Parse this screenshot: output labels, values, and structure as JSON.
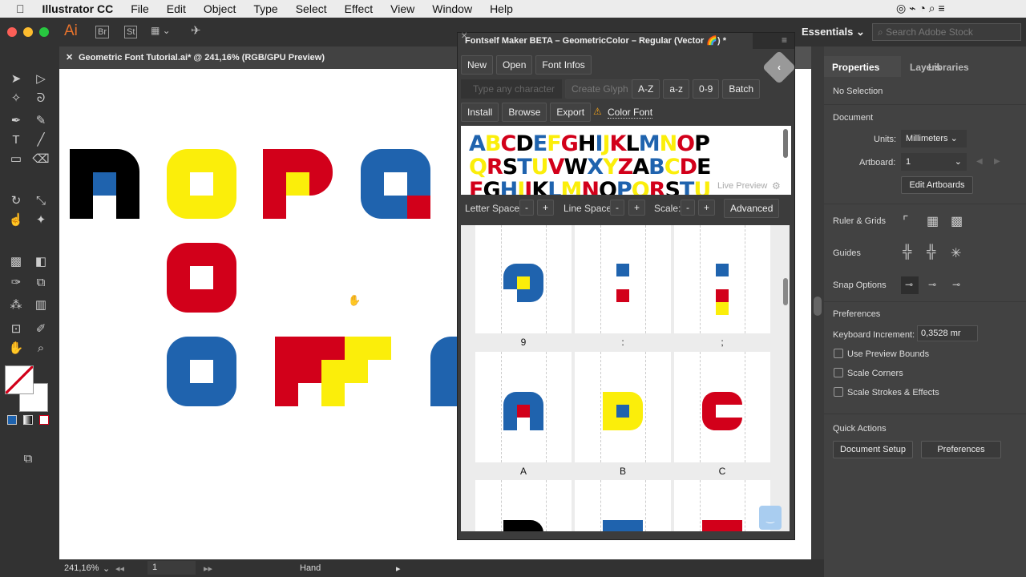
{
  "menubar": {
    "app": "Illustrator CC",
    "items": [
      "File",
      "Edit",
      "Object",
      "Type",
      "Select",
      "Effect",
      "View",
      "Window",
      "Help"
    ]
  },
  "appbar": {
    "logo": "Ai",
    "bridge": "Br",
    "stock": "St",
    "workspace": "Essentials",
    "search_placeholder": "Search Adobe Stock"
  },
  "document": {
    "tab_title": "Geometric Font Tutorial.ai* @ 241,16% (RGB/GPU Preview)"
  },
  "status": {
    "zoom": "241,16%",
    "artboard": "1",
    "tool": "Hand"
  },
  "plugin": {
    "title": "Fontself Maker BETA – GeometricColor – Regular (Vector 🌈) *",
    "buttons_row1": [
      "New",
      "Open",
      "Font Infos"
    ],
    "char_placeholder": "Type any character",
    "create_glyph": "Create Glyph",
    "buttons_row2": [
      "A-Z",
      "a-z",
      "0-9",
      "Batch"
    ],
    "buttons_row3": [
      "Install",
      "Browse",
      "Export"
    ],
    "color_font": "Color Font",
    "preview_lines": [
      "ABCDEFGHIJKLMNOP",
      "QRSTUVWXYZABCDE",
      "FGHIJKLMNOPQRSTU"
    ],
    "live_preview": "Live Preview",
    "letter_space": "Letter Space:",
    "line_space": "Line Space:",
    "scale": "Scale:",
    "minus": "-",
    "plus": "+",
    "advanced": "Advanced",
    "glyph_labels": [
      "9",
      ":",
      ";",
      "A",
      "B",
      "C"
    ]
  },
  "properties": {
    "tabs": [
      "Properties",
      "Layers",
      "Libraries"
    ],
    "no_selection": "No Selection",
    "document": "Document",
    "units_label": "Units:",
    "units_value": "Millimeters",
    "artboard_label": "Artboard:",
    "artboard_value": "1",
    "edit_artboards": "Edit Artboards",
    "ruler_grids": "Ruler & Grids",
    "guides": "Guides",
    "snap_options": "Snap Options",
    "preferences_heading": "Preferences",
    "keyboard_increment_label": "Keyboard Increment:",
    "keyboard_increment_value": "0,3528 mr",
    "checkboxes": [
      "Use Preview Bounds",
      "Scale Corners",
      "Scale Strokes & Effects"
    ],
    "quick_actions": "Quick Actions",
    "document_setup": "Document Setup",
    "preferences_button": "Preferences"
  },
  "colors": {
    "blue": "#1f63ae",
    "red": "#d2001a",
    "yellow": "#fbee0a",
    "black": "#000000"
  }
}
